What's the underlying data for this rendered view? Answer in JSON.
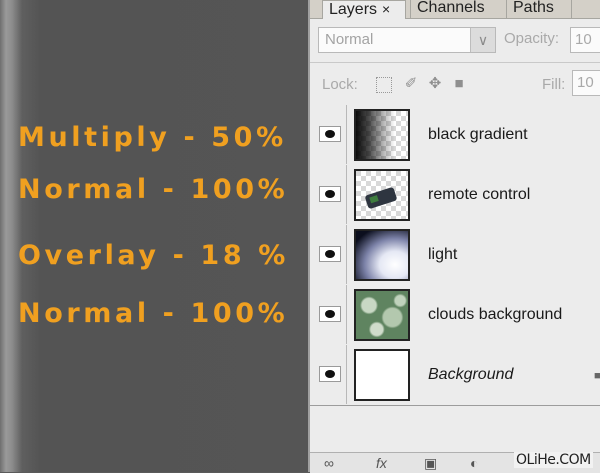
{
  "blend_labels": [
    {
      "text": "Multiply - 50%"
    },
    {
      "text": "Normal - 100%"
    },
    {
      "text": "Overlay - 18 %"
    },
    {
      "text": "Normal - 100%"
    }
  ],
  "panel": {
    "tabs": [
      {
        "label": "Layers",
        "active": true,
        "close": "×"
      },
      {
        "label": "Channels"
      },
      {
        "label": "Paths"
      }
    ],
    "blend_mode": "Normal",
    "opacity_label": "Opacity:",
    "opacity_value": "10",
    "lock_label": "Lock:",
    "fill_label": "Fill:",
    "fill_value": "10",
    "layers": [
      {
        "name": "black gradient",
        "visible": true
      },
      {
        "name": "remote control",
        "visible": true
      },
      {
        "name": "light",
        "visible": true
      },
      {
        "name": "clouds background",
        "visible": true
      },
      {
        "name": "Background",
        "visible": true,
        "locked": true
      }
    ]
  },
  "watermark": "OLiHe.COM"
}
